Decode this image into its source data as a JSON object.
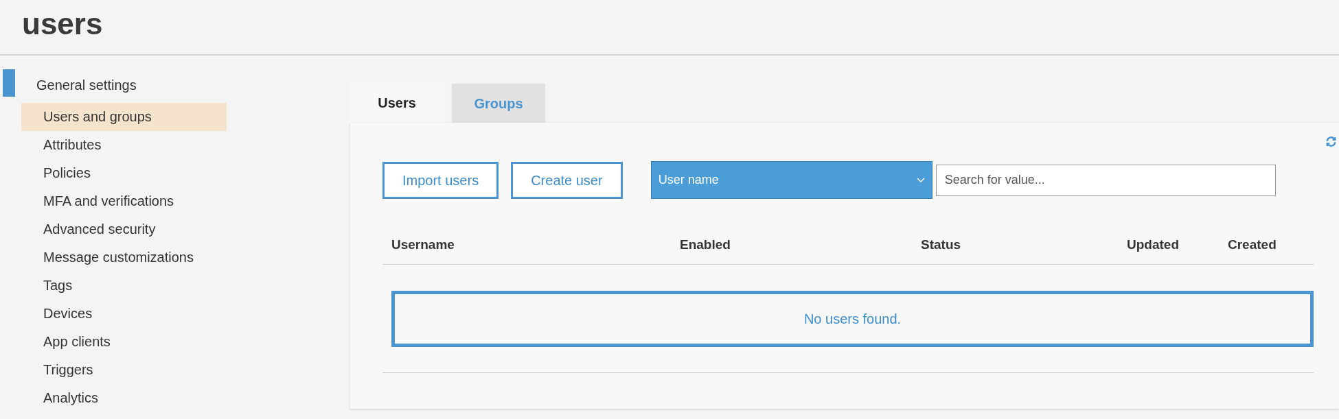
{
  "page_title": "users",
  "sidebar": {
    "section": "General settings",
    "items": [
      {
        "label": "Users and groups",
        "selected": true
      },
      {
        "label": "Attributes",
        "selected": false
      },
      {
        "label": "Policies",
        "selected": false
      },
      {
        "label": "MFA and verifications",
        "selected": false
      },
      {
        "label": "Advanced security",
        "selected": false
      },
      {
        "label": "Message customizations",
        "selected": false
      },
      {
        "label": "Tags",
        "selected": false
      },
      {
        "label": "Devices",
        "selected": false
      },
      {
        "label": "App clients",
        "selected": false
      },
      {
        "label": "Triggers",
        "selected": false
      },
      {
        "label": "Analytics",
        "selected": false
      }
    ]
  },
  "tabs": [
    {
      "label": "Users",
      "selected": true
    },
    {
      "label": "Groups",
      "selected": false
    }
  ],
  "buttons": [
    "Import users",
    "Create user"
  ],
  "filter": {
    "value": "User name"
  },
  "search": {
    "placeholder": "Search for value..."
  },
  "table": {
    "columns": [
      "Username",
      "Enabled",
      "Status",
      "Updated",
      "Created"
    ],
    "empty_message": "No users found."
  }
}
